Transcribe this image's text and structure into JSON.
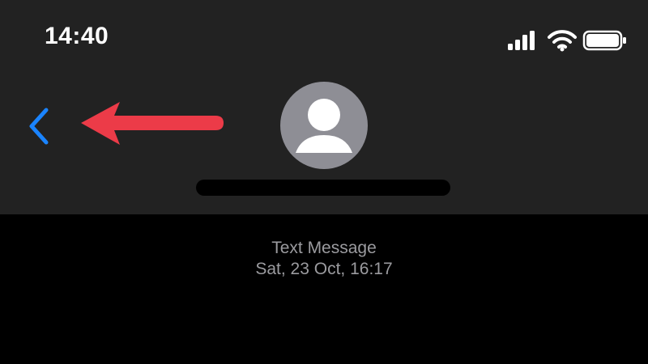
{
  "status_bar": {
    "time": "14:40",
    "icons": [
      "cellular-signal-icon",
      "wifi-icon",
      "battery-icon"
    ]
  },
  "navigation": {
    "back_icon": "chevron-left-icon",
    "annotation": "red-arrow-pointing-left"
  },
  "contact": {
    "avatar_icon": "person-silhouette-icon"
  },
  "conversation": {
    "service_label": "Text Message",
    "timestamp": "Sat, 23 Oct, 16:17"
  },
  "colors": {
    "header_background": "#222222",
    "page_background": "#000000",
    "accent_blue": "#1a84ff",
    "annotation_red": "#ec3b48",
    "avatar_gray": "#8e8e95",
    "muted_text": "#9b9b9f"
  }
}
